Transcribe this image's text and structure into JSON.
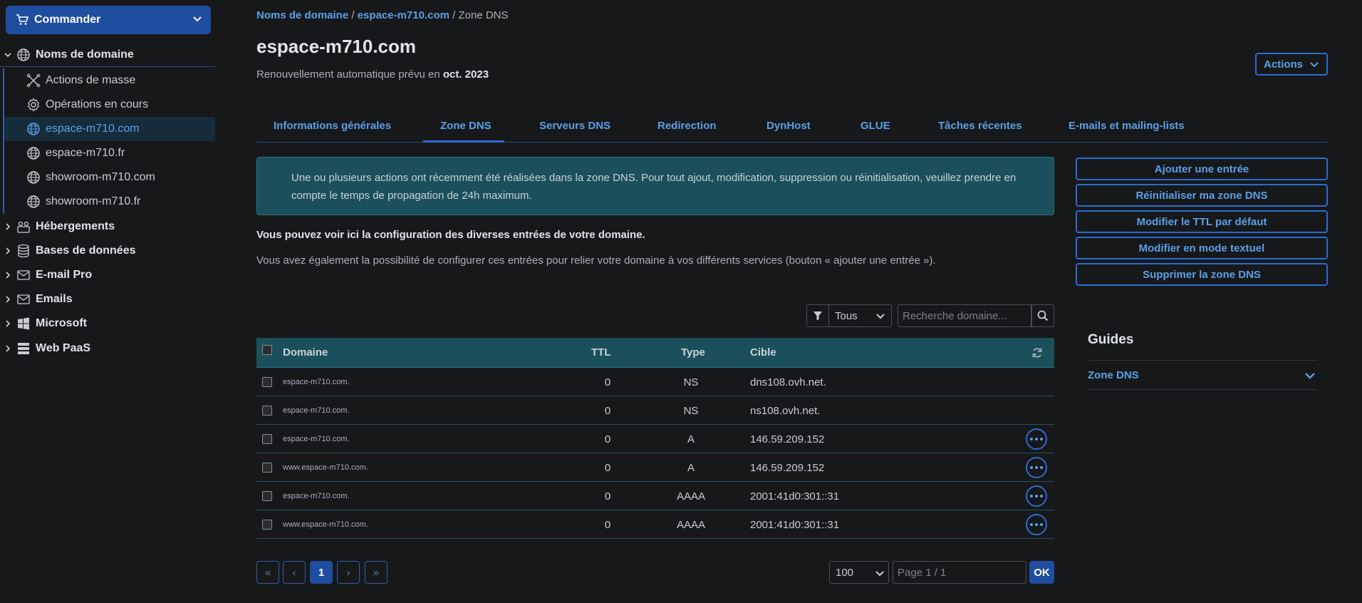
{
  "sidebar": {
    "order_label": "Commander",
    "domains_label": "Noms de domaine",
    "sub_items": [
      {
        "label": "Actions de masse",
        "icon": "bulk-actions-icon"
      },
      {
        "label": "Opérations en cours",
        "icon": "gear-icon"
      },
      {
        "label": "espace-m710.com",
        "icon": "globe-icon"
      },
      {
        "label": "espace-m710.fr",
        "icon": "globe-icon"
      },
      {
        "label": "showroom-m710.com",
        "icon": "globe-icon"
      },
      {
        "label": "showroom-m710.fr",
        "icon": "globe-icon"
      }
    ],
    "roots": [
      {
        "label": "Hébergements",
        "icon": "hosting-icon"
      },
      {
        "label": "Bases de données",
        "icon": "database-icon"
      },
      {
        "label": "E-mail Pro",
        "icon": "mail-icon"
      },
      {
        "label": "Emails",
        "icon": "mail-icon"
      },
      {
        "label": "Microsoft",
        "icon": "windows-icon"
      },
      {
        "label": "Web PaaS",
        "icon": "stack-icon"
      }
    ]
  },
  "breadcrumb": {
    "item1": "Noms de domaine",
    "sep1": " / ",
    "item2": "espace-m710.com",
    "sep2": " / ",
    "item3": "Zone DNS"
  },
  "header": {
    "title": "espace-m710.com",
    "renewal_prefix": "Renouvellement automatique prévu en ",
    "renewal_date": "oct. 2023",
    "actions_label": "Actions"
  },
  "tabs": [
    {
      "label": "Informations générales"
    },
    {
      "label": "Zone DNS"
    },
    {
      "label": "Serveurs DNS"
    },
    {
      "label": "Redirection"
    },
    {
      "label": "DynHost"
    },
    {
      "label": "GLUE"
    },
    {
      "label": "Tâches récentes"
    },
    {
      "label": "E-mails et mailing-lists"
    }
  ],
  "info_message": "Une ou plusieurs actions ont récemment été réalisées dans la zone DNS. Pour tout ajout, modification, suppression ou réinitialisation, veuillez prendre en compte le temps de propagation de 24h maximum.",
  "description": {
    "line1": "Vous pouvez voir ici la configuration des diverses entrées de votre domaine.",
    "line2": "Vous avez également la possibilité de configurer ces entrées pour relier votre domaine à vos différents services (bouton « ajouter une entrée »)."
  },
  "side_actions": {
    "add": "Ajouter une entrée",
    "reset": "Réinitialiser ma zone DNS",
    "ttl": "Modifier le TTL par défaut",
    "text_mode": "Modifier en mode textuel",
    "delete": "Supprimer la zone DNS"
  },
  "filter": {
    "selected": "Tous",
    "search_placeholder": "Recherche domaine..."
  },
  "table": {
    "headers": {
      "domain": "Domaine",
      "ttl": "TTL",
      "type": "Type",
      "target": "Cible"
    },
    "rows": [
      {
        "domain": "espace-m710.com.",
        "ttl": "0",
        "type": "NS",
        "target": "dns108.ovh.net.",
        "has_menu": false
      },
      {
        "domain": "espace-m710.com.",
        "ttl": "0",
        "type": "NS",
        "target": "ns108.ovh.net.",
        "has_menu": false
      },
      {
        "domain": "espace-m710.com.",
        "ttl": "0",
        "type": "A",
        "target": "146.59.209.152",
        "has_menu": true
      },
      {
        "domain": "www.espace-m710.com.",
        "ttl": "0",
        "type": "A",
        "target": "146.59.209.152",
        "has_menu": true
      },
      {
        "domain": "espace-m710.com.",
        "ttl": "0",
        "type": "AAAA",
        "target": "2001:41d0:301::31",
        "has_menu": true
      },
      {
        "domain": "www.espace-m710.com.",
        "ttl": "0",
        "type": "AAAA",
        "target": "2001:41d0:301::31",
        "has_menu": true
      }
    ]
  },
  "pagination": {
    "first": "«",
    "prev": "‹",
    "current": "1",
    "next": "›",
    "last": "»",
    "page_size": "100",
    "page_placeholder": "Page 1 / 1",
    "ok_label": "OK"
  },
  "guides": {
    "title": "Guides",
    "item": "Zone DNS"
  },
  "colors": {
    "accent": "#2d6bd0",
    "link": "#5aa0e8",
    "table_header": "#1b4f5c",
    "background": "#17181a"
  }
}
